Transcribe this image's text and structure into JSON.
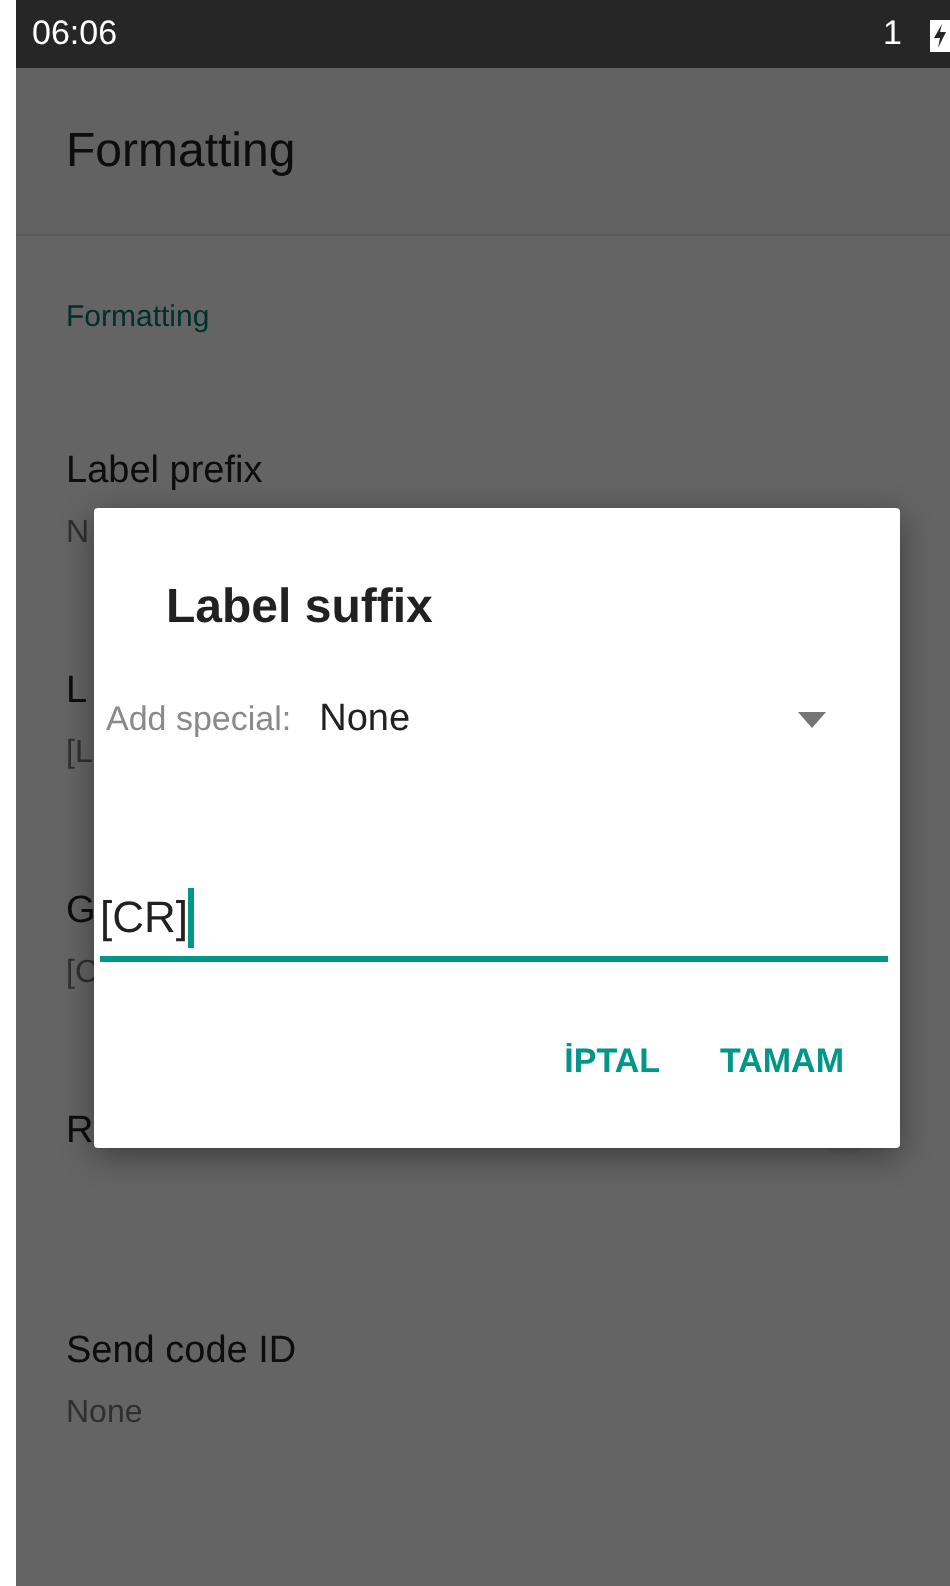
{
  "status_bar": {
    "time": "06:06",
    "notification_count": "1"
  },
  "toolbar": {
    "title": "Formatting"
  },
  "section_header": "Formatting",
  "settings": [
    {
      "title": "Label prefix",
      "summary": "N"
    },
    {
      "title": "L",
      "summary": "[L"
    },
    {
      "title": "G",
      "summary": "[C"
    },
    {
      "title": "R"
    },
    {
      "title": "Send code ID",
      "summary": "None"
    }
  ],
  "dialog": {
    "title": "Label suffix",
    "spinner": {
      "label": "Add special:",
      "value": "None"
    },
    "input": {
      "value": "[CR]"
    },
    "buttons": [
      "İPTAL",
      "TAMAM"
    ]
  }
}
